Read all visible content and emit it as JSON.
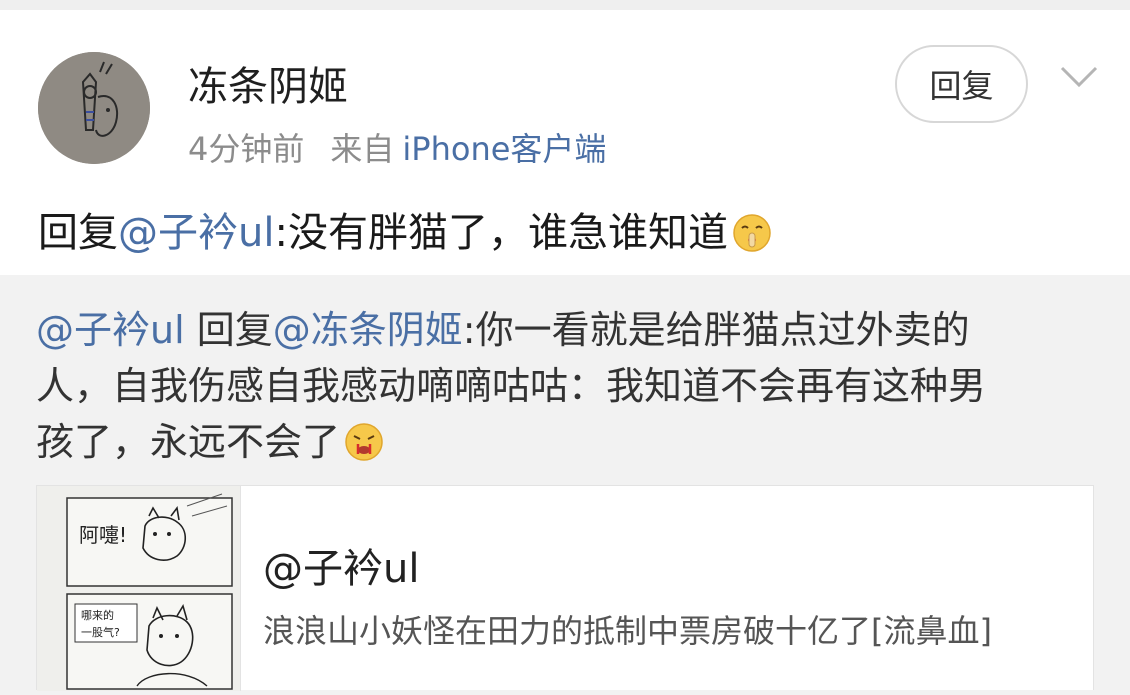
{
  "post": {
    "username": "冻条阴姬",
    "time": "4分钟前",
    "source_prefix": "来自",
    "source_client": "iPhone客户端",
    "reply_button": "回复",
    "content": {
      "prefix": "回复",
      "mention": "@子衿ul",
      "text": ":没有胖猫了，谁急谁知道"
    },
    "content_emoji": "shush-face-emoji"
  },
  "quote": {
    "mention1": "@子衿ul",
    "reply_word": " 回复",
    "mention2": "@冻条阴姬",
    "line1_text": ":你一看就是给胖猫点过外卖的",
    "line2": "人，自我伤感自我感动嘀嘀咕咕：我知道不会再有这种男",
    "line3": "孩了，永远不会了",
    "emoji": "nosebleed-emoji"
  },
  "link_card": {
    "title": "@子衿ul",
    "description": "浪浪山小妖怪在田力的抵制中票房破十亿了[流鼻血]",
    "thumbnail": "comic-thumbnail",
    "thumbnail_text": {
      "panel1": "阿嚏!",
      "panel2_line1": "哪来的",
      "panel2_line2": "一股气?"
    }
  },
  "colors": {
    "link": "#4a6fa5",
    "secondary_text": "#8c8c8c",
    "background": "#f2f2f2",
    "card": "#ffffff"
  }
}
